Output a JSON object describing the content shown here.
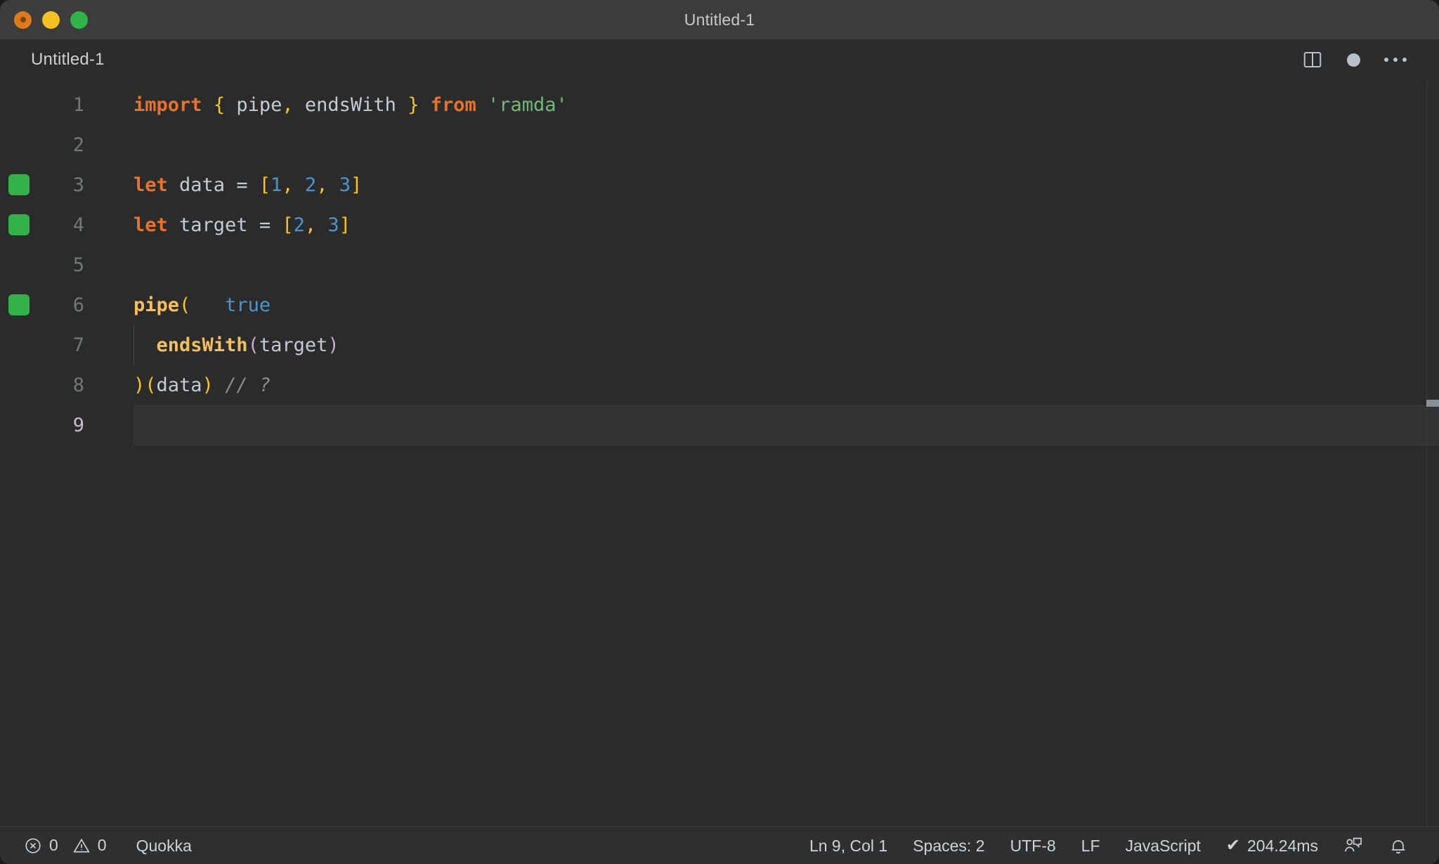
{
  "window": {
    "title": "Untitled-1",
    "traffic_lights": [
      {
        "name": "close",
        "color": "#dd7a1d"
      },
      {
        "name": "minimize",
        "color": "#f4c022"
      },
      {
        "name": "maximize",
        "color": "#2eb44a"
      }
    ]
  },
  "tab": {
    "label": "Untitled-1",
    "dirty": true
  },
  "header_actions": {
    "split_editor": "split-editor-right-icon",
    "unsaved_dot": "unsaved-indicator-dot",
    "more_actions": "more-actions-ellipsis-icon"
  },
  "editor": {
    "active_line": 9,
    "lines": [
      {
        "n": 1,
        "mark": false,
        "indent_guide": false,
        "tokens": [
          {
            "t": "import",
            "c": "kw"
          },
          {
            "t": " ",
            "c": "punct"
          },
          {
            "t": "{",
            "c": "brace"
          },
          {
            "t": " pipe",
            "c": "ident"
          },
          {
            "t": ",",
            "c": "brace"
          },
          {
            "t": " endsWith ",
            "c": "ident"
          },
          {
            "t": "}",
            "c": "brace"
          },
          {
            "t": " ",
            "c": "punct"
          },
          {
            "t": "from",
            "c": "kw"
          },
          {
            "t": " ",
            "c": "punct"
          },
          {
            "t": "'ramda'",
            "c": "str"
          }
        ]
      },
      {
        "n": 2,
        "mark": false,
        "indent_guide": false,
        "tokens": []
      },
      {
        "n": 3,
        "mark": true,
        "indent_guide": false,
        "tokens": [
          {
            "t": "let",
            "c": "kw"
          },
          {
            "t": " data ",
            "c": "ident"
          },
          {
            "t": "=",
            "c": "punct"
          },
          {
            "t": " ",
            "c": "punct"
          },
          {
            "t": "[",
            "c": "brace"
          },
          {
            "t": "1",
            "c": "num"
          },
          {
            "t": ",",
            "c": "brace"
          },
          {
            "t": " ",
            "c": "punct"
          },
          {
            "t": "2",
            "c": "num"
          },
          {
            "t": ",",
            "c": "brace"
          },
          {
            "t": " ",
            "c": "punct"
          },
          {
            "t": "3",
            "c": "num"
          },
          {
            "t": "]",
            "c": "brace"
          }
        ]
      },
      {
        "n": 4,
        "mark": true,
        "indent_guide": false,
        "tokens": [
          {
            "t": "let",
            "c": "kw"
          },
          {
            "t": " target ",
            "c": "ident"
          },
          {
            "t": "=",
            "c": "punct"
          },
          {
            "t": " ",
            "c": "punct"
          },
          {
            "t": "[",
            "c": "brace"
          },
          {
            "t": "2",
            "c": "num"
          },
          {
            "t": ",",
            "c": "brace"
          },
          {
            "t": " ",
            "c": "punct"
          },
          {
            "t": "3",
            "c": "num"
          },
          {
            "t": "]",
            "c": "brace"
          }
        ]
      },
      {
        "n": 5,
        "mark": false,
        "indent_guide": false,
        "tokens": []
      },
      {
        "n": 6,
        "mark": true,
        "indent_guide": false,
        "tokens": [
          {
            "t": "pipe",
            "c": "fn"
          },
          {
            "t": "(",
            "c": "brace"
          },
          {
            "t": "   ",
            "c": "punct"
          },
          {
            "t": "true",
            "c": "quokka-val"
          }
        ]
      },
      {
        "n": 7,
        "mark": false,
        "indent_guide": true,
        "tokens": [
          {
            "t": "  ",
            "c": "punct"
          },
          {
            "t": "endsWith",
            "c": "fn"
          },
          {
            "t": "(",
            "c": "paren-p"
          },
          {
            "t": "target",
            "c": "ident"
          },
          {
            "t": ")",
            "c": "paren-p"
          }
        ]
      },
      {
        "n": 8,
        "mark": false,
        "indent_guide": false,
        "tokens": [
          {
            "t": ")",
            "c": "brace"
          },
          {
            "t": "(",
            "c": "brace"
          },
          {
            "t": "data",
            "c": "ident"
          },
          {
            "t": ")",
            "c": "brace"
          },
          {
            "t": " ",
            "c": "punct"
          },
          {
            "t": "// ?",
            "c": "comment"
          }
        ]
      },
      {
        "n": 9,
        "mark": false,
        "indent_guide": false,
        "tokens": []
      }
    ]
  },
  "statusbar": {
    "errors_icon": "error-circle-icon",
    "errors": "0",
    "warnings_icon": "warning-triangle-icon",
    "warnings": "0",
    "extension": "Quokka",
    "cursor_position": "Ln 9, Col 1",
    "indentation": "Spaces: 2",
    "encoding": "UTF-8",
    "eol": "LF",
    "language": "JavaScript",
    "run_check": "✔",
    "run_time": "204.24ms",
    "feedback_icon": "feedback-person-icon",
    "bell_icon": "notifications-bell-icon"
  },
  "colors": {
    "titlebar_bg": "#3c3c3c",
    "editor_bg": "#2b2b2b",
    "statusbar_bg": "#2f2f2f",
    "keyword": "#e8722a",
    "string": "#72b879",
    "number": "#4b94cc",
    "brace": "#f9c22b",
    "function": "#f5be5e",
    "paren_purple": "#c8aacd",
    "comment": "#8a8f8a",
    "identifier": "#c4cbd4",
    "quokka_marker": "#33b24a",
    "quokka_value": "#4b94cc"
  }
}
